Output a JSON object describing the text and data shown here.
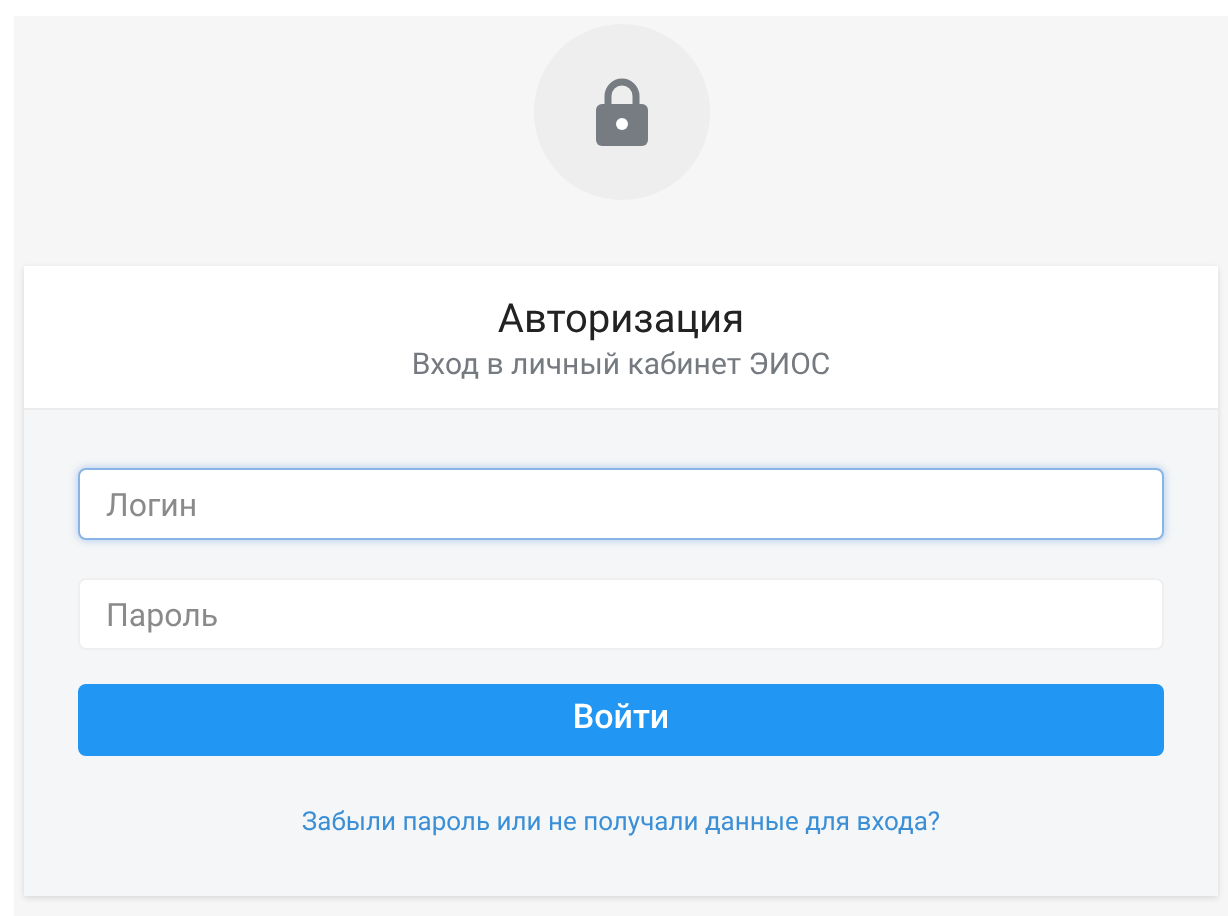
{
  "header": {
    "title": "Авторизация",
    "subtitle": "Вход в личный кабинет ЭИОС"
  },
  "fields": [
    {
      "placeholder": "Логин",
      "focused": true
    },
    {
      "placeholder": "Пароль",
      "focused": false
    }
  ],
  "submit": {
    "label": "Войти"
  },
  "forgot_link": "Забыли пароль или не получали данные для входа?"
}
